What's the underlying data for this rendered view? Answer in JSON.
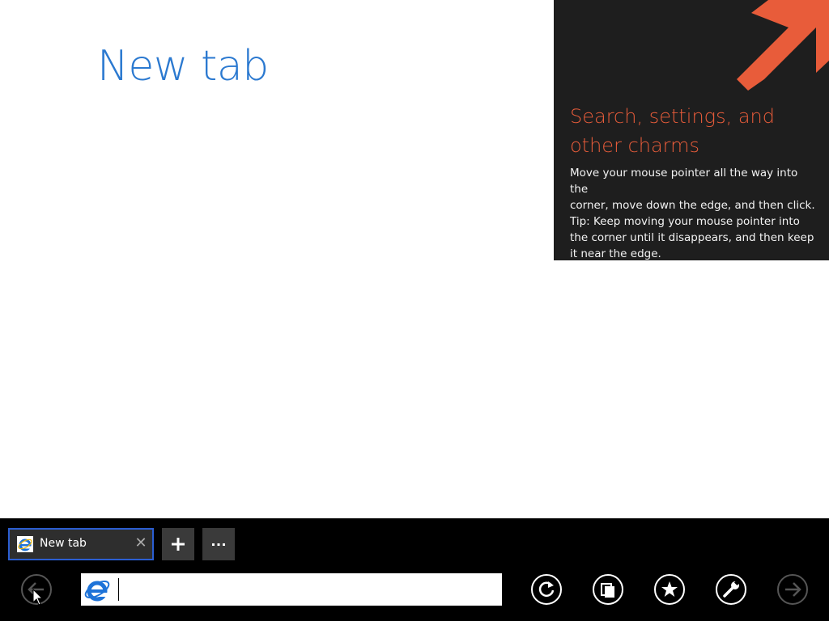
{
  "page": {
    "title": "New tab"
  },
  "charms_tip": {
    "title_line1": "Search, settings, and",
    "title_line2": "other charms",
    "body_line1": "Move your mouse pointer all the way into the",
    "body_line2": "corner, move down the edge, and then click.",
    "body_line3": "Tip: Keep moving your mouse pointer into",
    "body_line4": "the corner until it disappears, and then keep",
    "body_line5": "it near the edge.",
    "accent_color": "#e85c3a",
    "arrow_icon": "arrow-up-right-icon"
  },
  "tab_bar": {
    "tabs": [
      {
        "label": "New tab",
        "icon": "ie-icon",
        "close_icon": "close-icon",
        "selected": true
      }
    ],
    "new_tab_icon": "plus-icon",
    "tab_tools_icon": "more-icon"
  },
  "nav_bar": {
    "address_value": "",
    "address_placeholder": "",
    "back_icon": "back-arrow-icon",
    "refresh_icon": "refresh-icon",
    "pin_icon": "pin-to-start-icon",
    "favorites_icon": "star-icon",
    "tools_icon": "wrench-icon",
    "forward_icon": "forward-arrow-icon"
  },
  "colors": {
    "title_blue": "#2b79d0",
    "tab_border": "#2b5ed1",
    "appbar_bg": "#000000"
  }
}
